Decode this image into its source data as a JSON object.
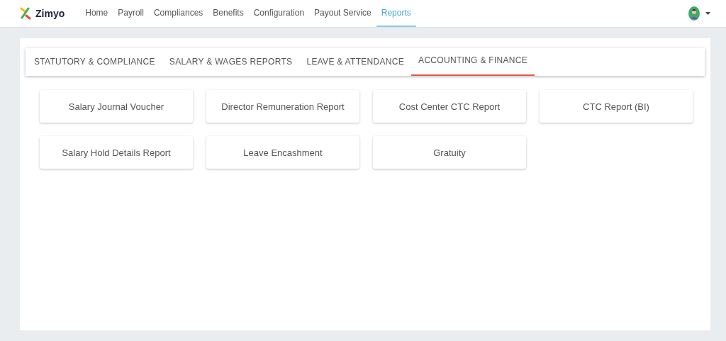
{
  "brand": "Zimyo",
  "nav": [
    {
      "label": "Home",
      "selected": false
    },
    {
      "label": "Payroll",
      "selected": false
    },
    {
      "label": "Compliances",
      "selected": false
    },
    {
      "label": "Benefits",
      "selected": false
    },
    {
      "label": "Configuration",
      "selected": false
    },
    {
      "label": "Payout Service",
      "selected": false
    },
    {
      "label": "Reports",
      "selected": true
    }
  ],
  "tabs": [
    {
      "label": "STATUTORY & COMPLIANCE",
      "selected": false
    },
    {
      "label": "SALARY & WAGES REPORTS",
      "selected": false
    },
    {
      "label": "LEAVE & ATTENDANCE",
      "selected": false
    },
    {
      "label": "ACCOUNTING & FINANCE",
      "selected": true
    }
  ],
  "reports": [
    "Salary Journal Voucher",
    "Director Remuneration Report",
    "Cost Center CTC Report",
    "CTC Report (BI)",
    "Salary Hold Details Report",
    "Leave Encashment",
    "Gratuity"
  ]
}
